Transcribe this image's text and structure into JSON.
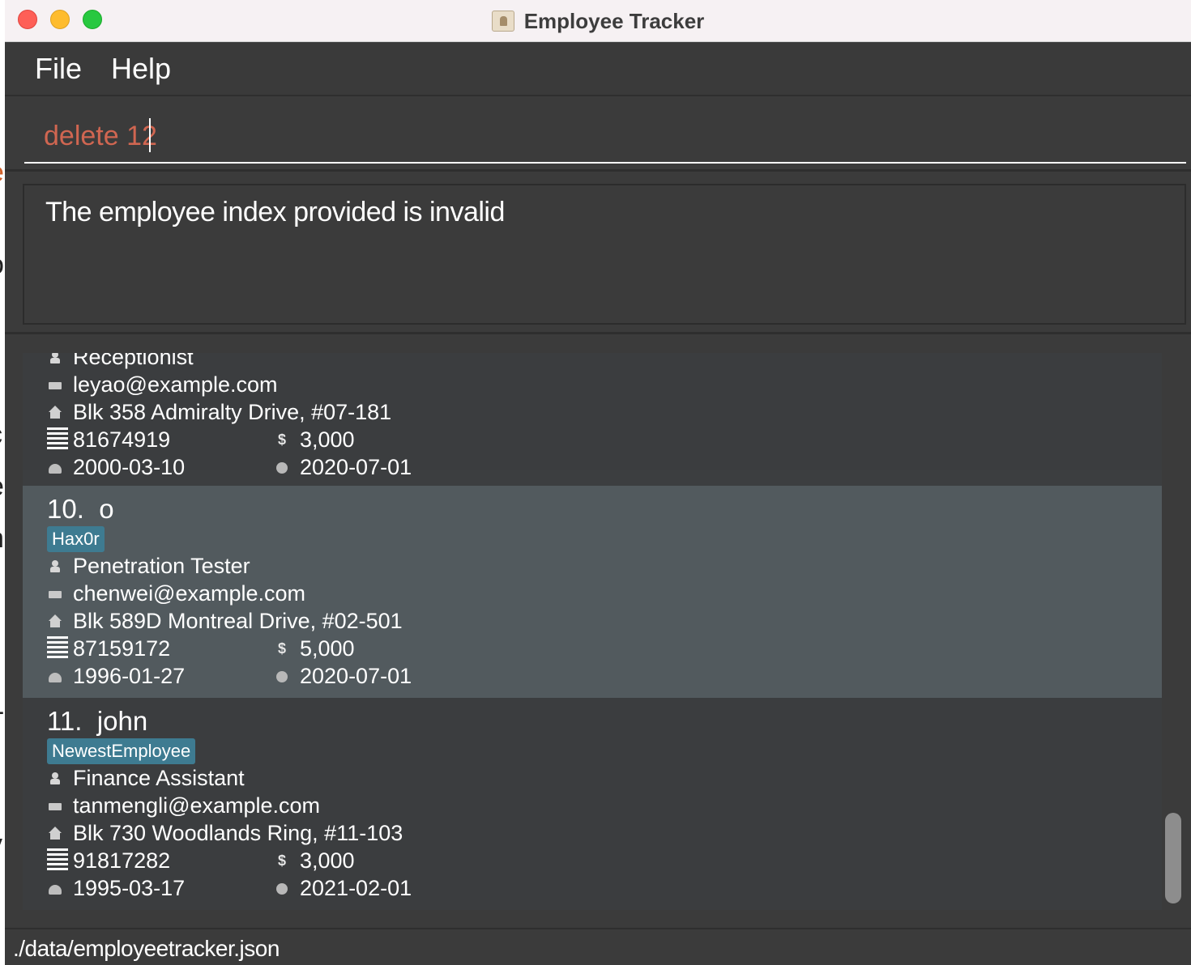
{
  "window": {
    "title": "Employee Tracker"
  },
  "menu": {
    "file": "File",
    "help": "Help"
  },
  "command": {
    "value": "delete 12",
    "placeholder": ""
  },
  "result": {
    "message": "The employee index provided is invalid"
  },
  "employees": {
    "partial": {
      "role": "Receptionist",
      "email": "leyao@example.com",
      "address": "Blk 358 Admiralty Drive, #07-181",
      "phone": "81674919",
      "salary": "3,000",
      "birthday": "2000-03-10",
      "start_date": "2020-07-01"
    },
    "selected": {
      "index": "10.",
      "name": "o",
      "tag": "Hax0r",
      "role": "Penetration Tester",
      "email": "chenwei@example.com",
      "address": "Blk 589D Montreal Drive, #02-501",
      "phone": "87159172",
      "salary": "5,000",
      "birthday": "1996-01-27",
      "start_date": "2020-07-01"
    },
    "plain": {
      "index": "11.",
      "name": "john",
      "tag": "NewestEmployee",
      "role": "Finance Assistant",
      "email": "tanmengli@example.com",
      "address": "Blk 730 Woodlands Ring, #11-103",
      "phone": "91817282",
      "salary": "3,000",
      "birthday": "1995-03-17",
      "start_date": "2021-02-01"
    }
  },
  "status": {
    "file_path": "./data/employeetracker.json"
  },
  "colors": {
    "window_bg": "#3b3b3b",
    "selected_card": "#525a5e",
    "tag_bg": "#3e7b91",
    "command_text": "#d06651"
  },
  "icons": {
    "role": "person-icon",
    "email": "mail-icon",
    "address": "house-icon",
    "phone": "phone-icon",
    "salary": "dollar-icon",
    "birthday": "cake-icon",
    "start_date": "clock-icon"
  }
}
